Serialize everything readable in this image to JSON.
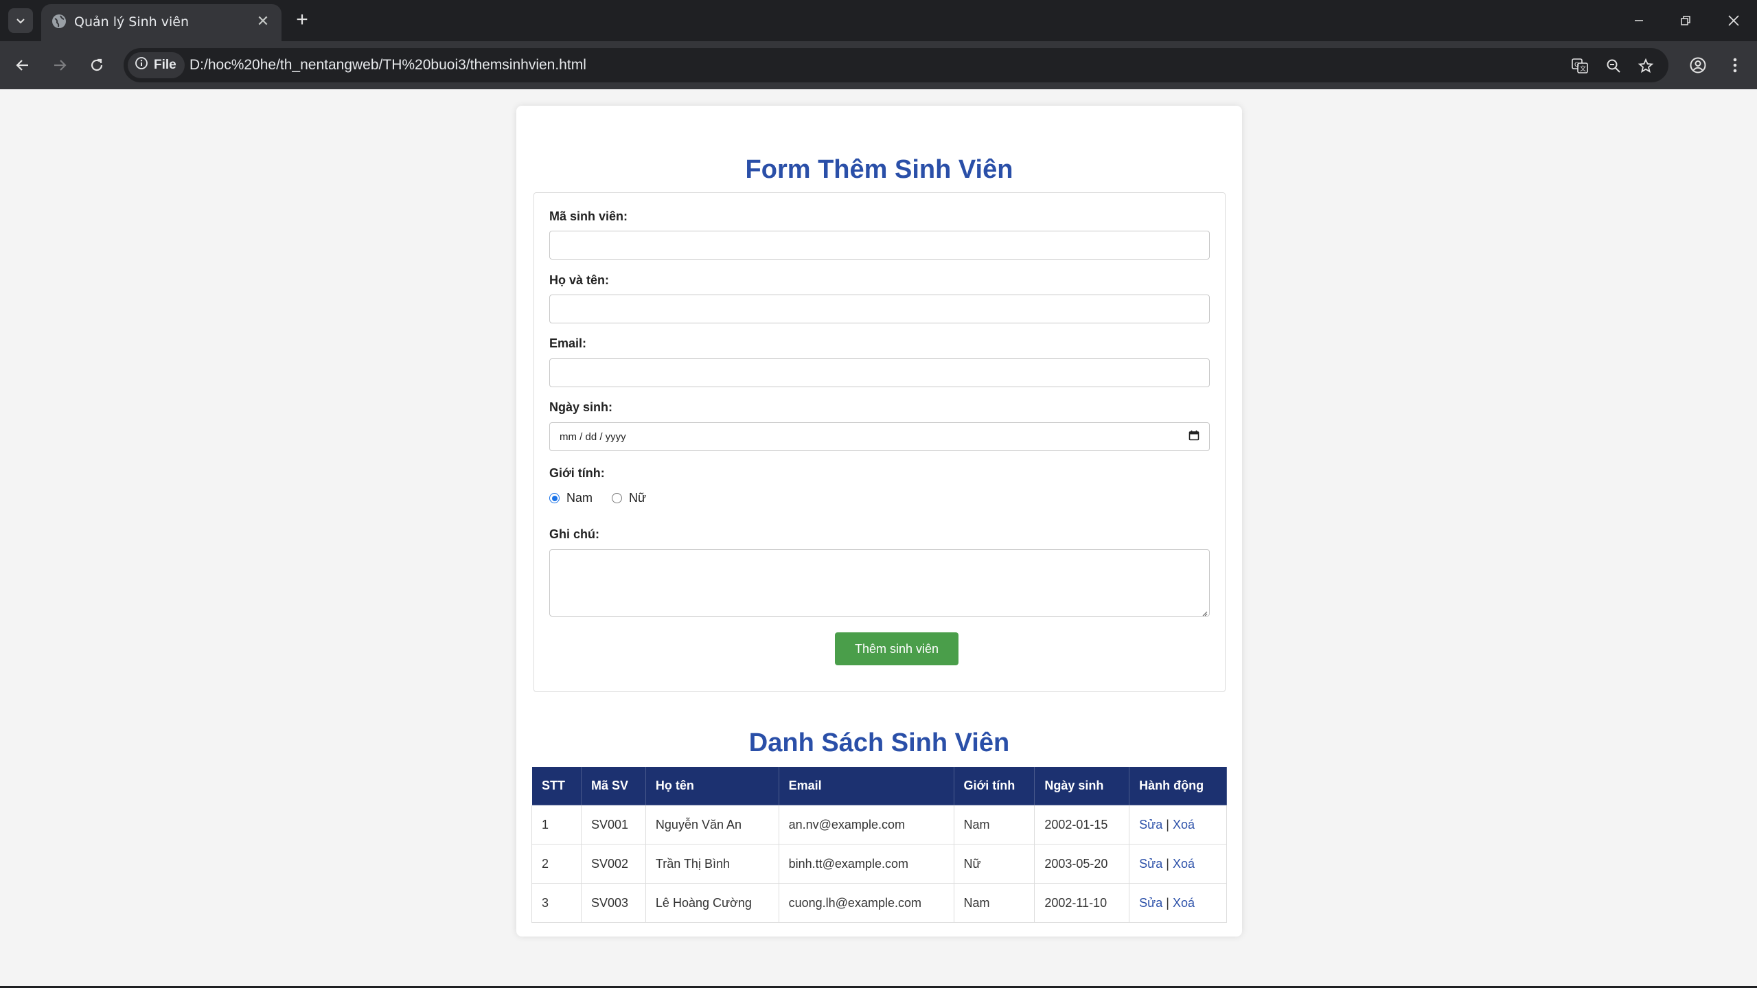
{
  "browser": {
    "tab_title": "Quản lý Sinh viên",
    "site_chip_label": "File",
    "url": "D:/hoc%20he/th_nentangweb/TH%20buoi3/themsinhvien.html"
  },
  "form": {
    "title": "Form Thêm Sinh Viên",
    "student_id_label": "Mã sinh viên:",
    "student_id_value": "",
    "fullname_label": "Họ và tên:",
    "fullname_value": "",
    "email_label": "Email:",
    "email_value": "",
    "dob_label": "Ngày sinh:",
    "dob_placeholder": "mm / dd / yyyy",
    "gender_label": "Giới tính:",
    "gender_options": [
      "Nam",
      "Nữ"
    ],
    "gender_selected": "Nam",
    "note_label": "Ghi chú:",
    "note_value": "",
    "submit_label": "Thêm sinh viên"
  },
  "list": {
    "title": "Danh Sách Sinh Viên",
    "columns": [
      "STT",
      "Mã SV",
      "Họ tên",
      "Email",
      "Giới tính",
      "Ngày sinh",
      "Hành động"
    ],
    "rows": [
      {
        "stt": "1",
        "id": "SV001",
        "name": "Nguyễn Văn An",
        "email": "an.nv@example.com",
        "gender": "Nam",
        "dob": "2002-01-15",
        "edit": "Sửa",
        "sep": "|",
        "delete": "Xoá"
      },
      {
        "stt": "2",
        "id": "SV002",
        "name": "Trần Thị Bình",
        "email": "binh.tt@example.com",
        "gender": "Nữ",
        "dob": "2003-05-20",
        "edit": "Sửa",
        "sep": "|",
        "delete": "Xoá"
      },
      {
        "stt": "3",
        "id": "SV003",
        "name": "Lê Hoàng Cường",
        "email": "cuong.lh@example.com",
        "gender": "Nam",
        "dob": "2002-11-10",
        "edit": "Sửa",
        "sep": "|",
        "delete": "Xoá"
      }
    ]
  },
  "colors": {
    "heading": "#2a4fa8",
    "table_header": "#1c3170",
    "submit_button": "#4a9e4a"
  }
}
